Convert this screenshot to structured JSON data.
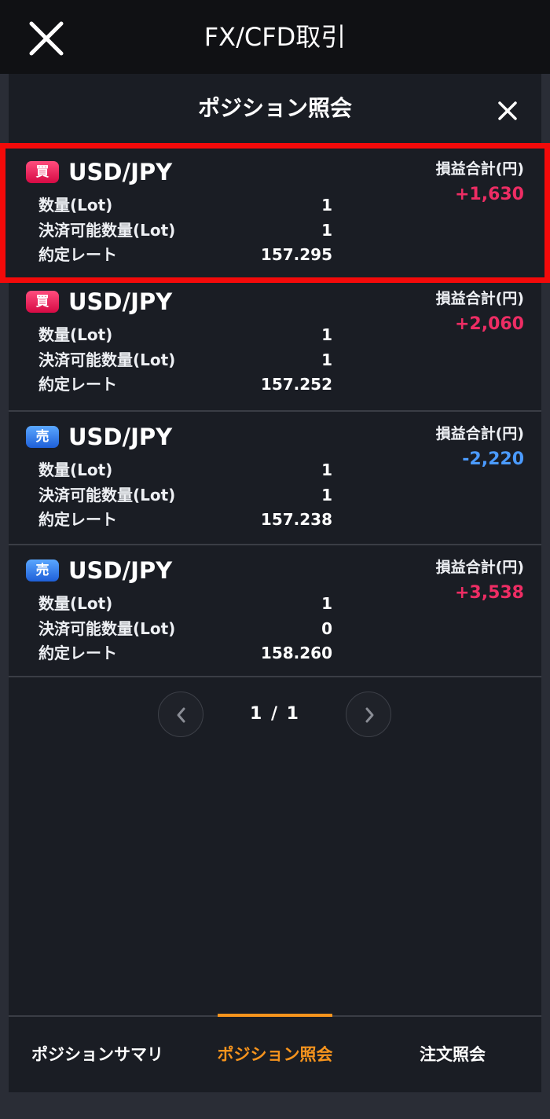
{
  "app": {
    "title": "FX/CFD取引"
  },
  "panel": {
    "title": "ポジション照会"
  },
  "labels": {
    "qty": "数量(Lot)",
    "settleable": "決済可能数量(Lot)",
    "rate": "約定レート",
    "pl": "損益合計(円)"
  },
  "positions": [
    {
      "side": "買",
      "pair": "USD/JPY",
      "qty": "1",
      "settleable": "1",
      "rate": "157.295",
      "pl": "+1,630"
    },
    {
      "side": "買",
      "pair": "USD/JPY",
      "qty": "1",
      "settleable": "1",
      "rate": "157.252",
      "pl": "+2,060"
    },
    {
      "side": "売",
      "pair": "USD/JPY",
      "qty": "1",
      "settleable": "1",
      "rate": "157.238",
      "pl": "-2,220"
    },
    {
      "side": "売",
      "pair": "USD/JPY",
      "qty": "1",
      "settleable": "0",
      "rate": "158.260",
      "pl": "+3,538"
    }
  ],
  "pager": {
    "text": "1 / 1"
  },
  "tabs": [
    {
      "label": "ポジションサマリ"
    },
    {
      "label": "ポジション照会"
    },
    {
      "label": "注文照会"
    }
  ],
  "colors": {
    "buy": "#e8195a",
    "sell": "#2f7cf0",
    "profit": "#ee2d64",
    "loss": "#4b9bff",
    "accent": "#f7941d",
    "highlight": "#f30a0a"
  }
}
